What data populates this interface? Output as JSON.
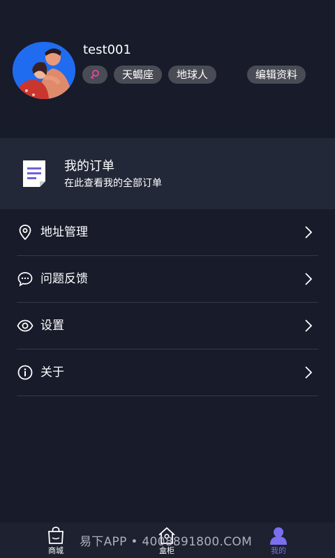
{
  "profile": {
    "username": "test001",
    "gender_icon": "female-symbol-icon",
    "tags": [
      "天蝎座",
      "地球人"
    ],
    "edit_label": "编辑资料"
  },
  "orders": {
    "title": "我的订单",
    "subtitle": "在此查看我的全部订单"
  },
  "menu": {
    "items": [
      {
        "label": "地址管理",
        "icon": "location-pin-icon"
      },
      {
        "label": "问题反馈",
        "icon": "chat-bubble-icon"
      },
      {
        "label": "设置",
        "icon": "eye-icon"
      },
      {
        "label": "关于",
        "icon": "info-icon"
      }
    ]
  },
  "nav": {
    "items": [
      {
        "label": "商城",
        "icon": "shopping-bag-icon"
      },
      {
        "label": "盒柜",
        "icon": "home-icon"
      },
      {
        "label": "我的",
        "icon": "user-icon",
        "active": true
      }
    ]
  },
  "watermark": "易下APP • 4008891800.COM",
  "colors": {
    "background": "#171b2a",
    "card": "#232838",
    "tag": "#4a4c55",
    "accent": "#7b6ff0",
    "avatar_bg": "#1f6cf0"
  }
}
